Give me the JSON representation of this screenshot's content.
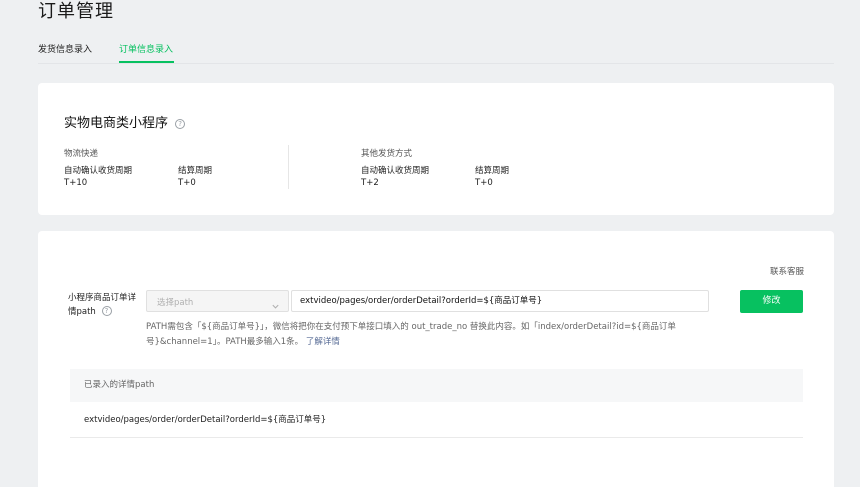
{
  "page": {
    "title": "订单管理"
  },
  "tabs": [
    {
      "label": "发货信息录入",
      "active": false
    },
    {
      "label": "订单信息录入",
      "active": true
    }
  ],
  "accent_color": "#07c160",
  "mini_program_card": {
    "title": "实物电商类小程序",
    "groups": [
      {
        "label": "物流快递",
        "items": [
          {
            "label": "自动确认收货周期",
            "value": "T+10"
          },
          {
            "label": "结算周期",
            "value": "T+0"
          }
        ]
      },
      {
        "label": "其他发货方式",
        "items": [
          {
            "label": "自动确认收货周期",
            "value": "T+2"
          },
          {
            "label": "结算周期",
            "value": "T+0"
          }
        ]
      }
    ]
  },
  "path_card": {
    "contact_link": "联系客服",
    "field_label": "小程序商品订单详情path",
    "select_placeholder": "选择path",
    "path_value": "extvideo/pages/order/orderDetail?orderId=${商品订单号}",
    "modify_button": "修改",
    "hint_text": "PATH需包含「${商品订单号}」，微信将把你在支付预下单接口填入的 out_trade_no 替换此内容。如「index/orderDetail?id=${商品订单号}&channel=1」。PATH最多输入1条。",
    "hint_link": "了解详情",
    "table_header": "已录入的详情path",
    "table_rows": [
      "extvideo/pages/order/orderDetail?orderId=${商品订单号}"
    ]
  }
}
